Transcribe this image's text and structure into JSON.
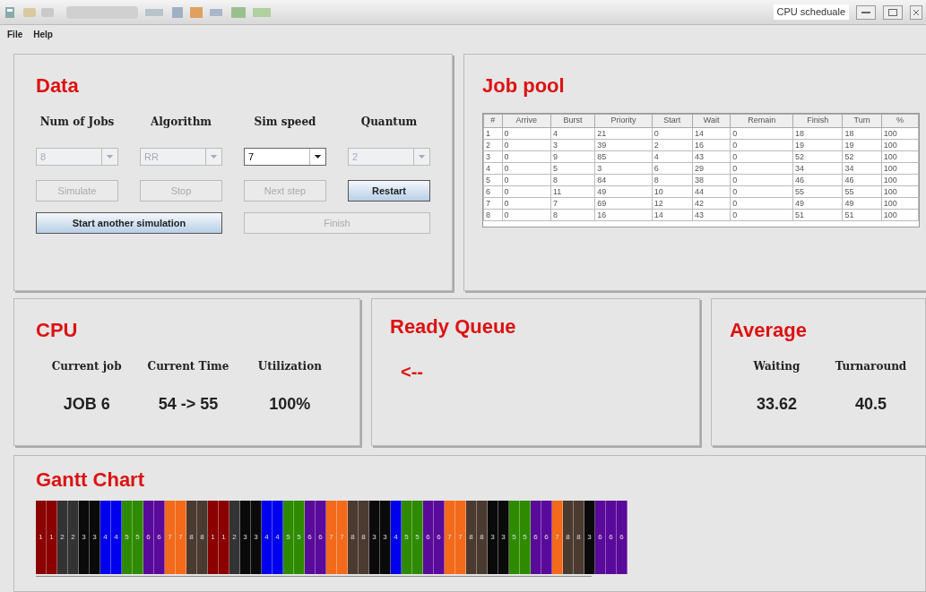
{
  "window": {
    "title": "CPU scheduale"
  },
  "menu": [
    "File",
    "Help"
  ],
  "data_panel": {
    "title": "Data",
    "fields": [
      {
        "label": "Num of Jobs",
        "value": "8",
        "disabled": true
      },
      {
        "label": "Algorithm",
        "value": "RR",
        "disabled": true
      },
      {
        "label": "Sim speed",
        "value": "7",
        "disabled": false
      },
      {
        "label": "Quantum",
        "value": "2",
        "disabled": true
      }
    ],
    "buttons": [
      {
        "label": "Simulate",
        "disabled": true
      },
      {
        "label": "Stop",
        "disabled": true
      },
      {
        "label": "Next step",
        "disabled": true
      },
      {
        "label": "Restart",
        "disabled": false
      }
    ],
    "wide_buttons": [
      {
        "label": "Start another simulation",
        "disabled": false
      },
      {
        "label": "Finish",
        "disabled": true
      }
    ]
  },
  "job_pool": {
    "title": "Job pool",
    "columns": [
      "#",
      "Arrive",
      "Burst",
      "Priority",
      "Start",
      "Wait",
      "Remain",
      "Finish",
      "Turn",
      "%"
    ],
    "rows": [
      [
        "1",
        "0",
        "4",
        "21",
        "0",
        "14",
        "0",
        "18",
        "18",
        "100"
      ],
      [
        "2",
        "0",
        "3",
        "39",
        "2",
        "16",
        "0",
        "19",
        "19",
        "100"
      ],
      [
        "3",
        "0",
        "9",
        "85",
        "4",
        "43",
        "0",
        "52",
        "52",
        "100"
      ],
      [
        "4",
        "0",
        "5",
        "3",
        "6",
        "29",
        "0",
        "34",
        "34",
        "100"
      ],
      [
        "5",
        "0",
        "8",
        "84",
        "8",
        "38",
        "0",
        "46",
        "46",
        "100"
      ],
      [
        "6",
        "0",
        "11",
        "49",
        "10",
        "44",
        "0",
        "55",
        "55",
        "100"
      ],
      [
        "7",
        "0",
        "7",
        "69",
        "12",
        "42",
        "0",
        "49",
        "49",
        "100"
      ],
      [
        "8",
        "0",
        "8",
        "16",
        "14",
        "43",
        "0",
        "51",
        "51",
        "100"
      ]
    ]
  },
  "cpu": {
    "title": "CPU",
    "stats": [
      {
        "label": "Current job",
        "value": "JOB 6"
      },
      {
        "label": "Current Time",
        "value": "54 -> 55"
      },
      {
        "label": "Utilization",
        "value": "100%"
      }
    ]
  },
  "ready_queue": {
    "title": "Ready Queue",
    "arrow": "<--"
  },
  "average": {
    "title": "Average",
    "stats": [
      {
        "label": "Waiting",
        "value": "33.62"
      },
      {
        "label": "Turnaround",
        "value": "40.5"
      }
    ]
  },
  "gantt": {
    "title": "Gantt Chart",
    "blocks": [
      {
        "label": "1",
        "color": "#8b0000"
      },
      {
        "label": "1",
        "color": "#8b0000"
      },
      {
        "label": "2",
        "color": "#333333"
      },
      {
        "label": "2",
        "color": "#333333"
      },
      {
        "label": "3",
        "color": "#0a0a0a"
      },
      {
        "label": "3",
        "color": "#0a0a0a"
      },
      {
        "label": "4",
        "color": "#0000ee"
      },
      {
        "label": "4",
        "color": "#0000ee"
      },
      {
        "label": "5",
        "color": "#2e8b00"
      },
      {
        "label": "5",
        "color": "#2e8b00"
      },
      {
        "label": "6",
        "color": "#5a0a9a"
      },
      {
        "label": "6",
        "color": "#5a0a9a"
      },
      {
        "label": "7",
        "color": "#f26a1a"
      },
      {
        "label": "7",
        "color": "#f26a1a"
      },
      {
        "label": "8",
        "color": "#4a3a30"
      },
      {
        "label": "8",
        "color": "#4a3a30"
      },
      {
        "label": "1",
        "color": "#8b0000"
      },
      {
        "label": "1",
        "color": "#8b0000"
      },
      {
        "label": "2",
        "color": "#333333"
      },
      {
        "label": "3",
        "color": "#0a0a0a"
      },
      {
        "label": "3",
        "color": "#0a0a0a"
      },
      {
        "label": "4",
        "color": "#0000ee"
      },
      {
        "label": "4",
        "color": "#0000ee"
      },
      {
        "label": "5",
        "color": "#2e8b00"
      },
      {
        "label": "5",
        "color": "#2e8b00"
      },
      {
        "label": "6",
        "color": "#5a0a9a"
      },
      {
        "label": "6",
        "color": "#5a0a9a"
      },
      {
        "label": "7",
        "color": "#f26a1a"
      },
      {
        "label": "7",
        "color": "#f26a1a"
      },
      {
        "label": "8",
        "color": "#4a3a30"
      },
      {
        "label": "8",
        "color": "#4a3a30"
      },
      {
        "label": "3",
        "color": "#0a0a0a"
      },
      {
        "label": "3",
        "color": "#0a0a0a"
      },
      {
        "label": "4",
        "color": "#0000ee"
      },
      {
        "label": "5",
        "color": "#2e8b00"
      },
      {
        "label": "5",
        "color": "#2e8b00"
      },
      {
        "label": "6",
        "color": "#5a0a9a"
      },
      {
        "label": "6",
        "color": "#5a0a9a"
      },
      {
        "label": "7",
        "color": "#f26a1a"
      },
      {
        "label": "7",
        "color": "#f26a1a"
      },
      {
        "label": "8",
        "color": "#4a3a30"
      },
      {
        "label": "8",
        "color": "#4a3a30"
      },
      {
        "label": "3",
        "color": "#0a0a0a"
      },
      {
        "label": "3",
        "color": "#0a0a0a"
      },
      {
        "label": "5",
        "color": "#2e8b00"
      },
      {
        "label": "5",
        "color": "#2e8b00"
      },
      {
        "label": "6",
        "color": "#5a0a9a"
      },
      {
        "label": "6",
        "color": "#5a0a9a"
      },
      {
        "label": "7",
        "color": "#f26a1a"
      },
      {
        "label": "8",
        "color": "#4a3a30"
      },
      {
        "label": "8",
        "color": "#4a3a30"
      },
      {
        "label": "3",
        "color": "#0a0a0a"
      },
      {
        "label": "6",
        "color": "#5a0a9a"
      },
      {
        "label": "6",
        "color": "#5a0a9a"
      },
      {
        "label": "6",
        "color": "#5a0a9a"
      }
    ]
  }
}
